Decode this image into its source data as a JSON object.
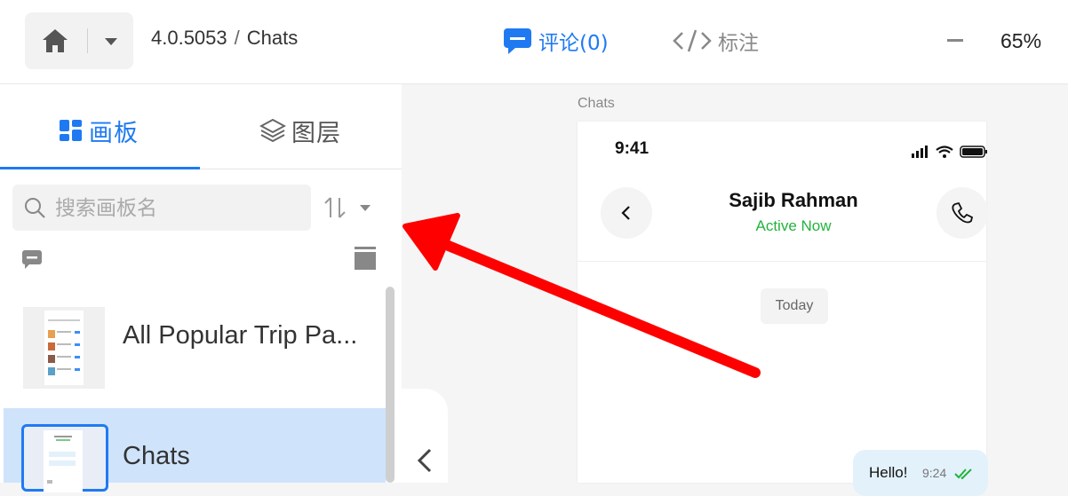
{
  "topbar": {
    "version": "4.0.5053",
    "separator": "/",
    "page_name": "Chats",
    "comment_tab_label": "评论(0)",
    "mark_tab_label": "标注",
    "zoom": "65%"
  },
  "left_panel": {
    "tab_boards": "画板",
    "tab_layers": "图层",
    "search_placeholder": "搜索画板名",
    "boards": [
      {
        "label": "All Popular Trip Pa..."
      },
      {
        "label": "Chats"
      }
    ]
  },
  "canvas": {
    "frame_label": "Chats",
    "status_time": "9:41",
    "contact_name": "Sajib Rahman",
    "contact_status": "Active Now",
    "date_divider": "Today",
    "message_text": "Hello!",
    "message_time": "9:24"
  },
  "colors": {
    "accent": "#1f7af2",
    "active_green": "#22b33b",
    "annotation_arrow": "#ff0000",
    "selected_row": "#cfe3fb"
  }
}
